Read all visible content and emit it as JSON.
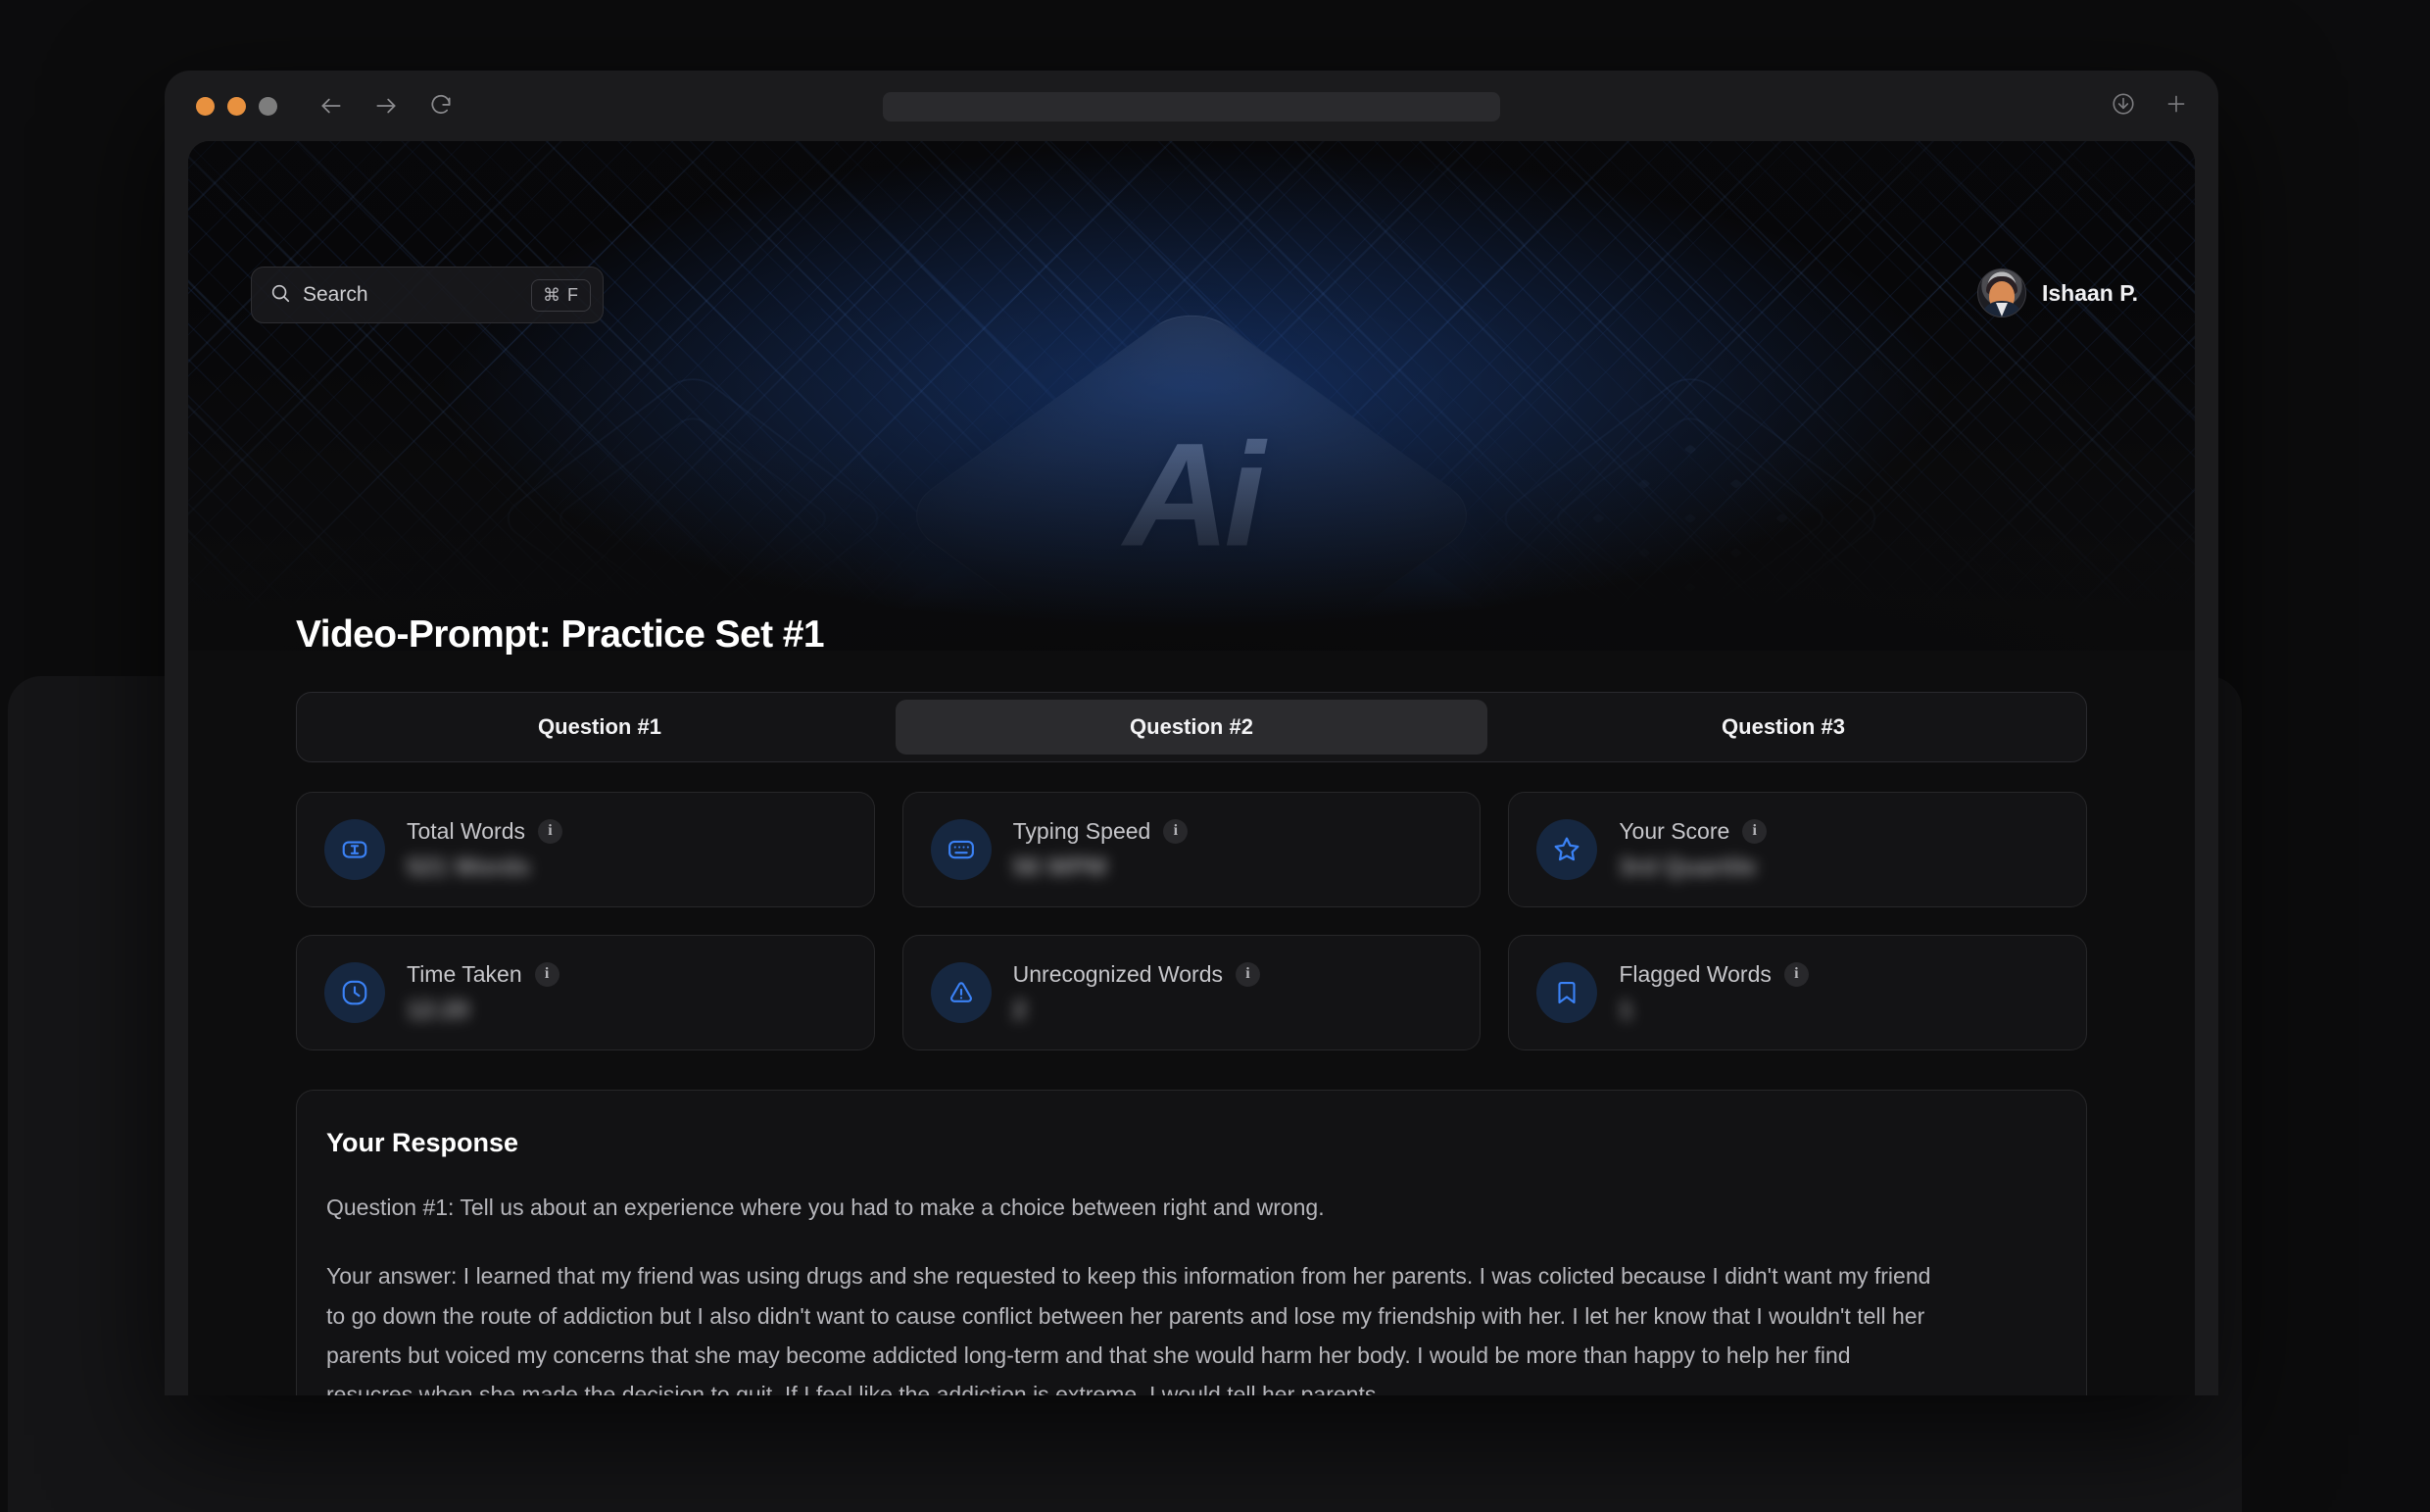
{
  "browser": {
    "back_icon": "back-arrow-icon",
    "forward_icon": "forward-arrow-icon",
    "reload_icon": "reload-icon",
    "download_icon": "download-icon",
    "new_tab_icon": "plus-icon",
    "url_value": ""
  },
  "search": {
    "placeholder": "Search",
    "shortcut": "⌘ F",
    "icon": "search-icon"
  },
  "user": {
    "name": "Ishaan P.",
    "avatar": "user-avatar"
  },
  "hero": {
    "logo_text": "Ai"
  },
  "page": {
    "title": "Video-Prompt: Practice Set #1"
  },
  "tabs": [
    {
      "label": "Question #1",
      "active": false
    },
    {
      "label": "Question #2",
      "active": true
    },
    {
      "label": "Question #3",
      "active": false
    }
  ],
  "stats": [
    {
      "label": "Total Words",
      "value": "521 Words",
      "icon": "text-cursor-icon",
      "info": "i"
    },
    {
      "label": "Typing Speed",
      "value": "56 WPM",
      "icon": "keyboard-icon",
      "info": "i"
    },
    {
      "label": "Your Score",
      "value": "3rd Quartile",
      "icon": "star-icon",
      "info": "i"
    },
    {
      "label": "Time Taken",
      "value": "12:20",
      "icon": "clock-icon",
      "info": "i"
    },
    {
      "label": "Unrecognized Words",
      "value": "2",
      "icon": "warning-triangle-icon",
      "info": "i"
    },
    {
      "label": "Flagged Words",
      "value": "1",
      "icon": "bookmark-icon",
      "info": "i"
    }
  ],
  "response": {
    "heading": "Your Response",
    "question": "Question #1: Tell us about an experience where you had to make a choice between right and wrong.",
    "answer": "Your answer: I learned that my friend was using drugs and she requested to keep this information from her parents. I was colicted because I didn't want my friend to go down the route of addiction but I also didn't want to cause conflict between her parents and lose my friendship with her. I let her know that I wouldn't tell her parents but voiced my concerns that she may become addicted long-term and that she would harm her body. I would be more than happy to help her find resucres when she made the decision to quit. If I feel like the addiction is extreme, I would tell her parents."
  },
  "colors": {
    "accent_blue": "#3b82f6",
    "icon_bg": "#162740",
    "card_bg": "#131315",
    "page_bg": "#0d0d0e"
  }
}
